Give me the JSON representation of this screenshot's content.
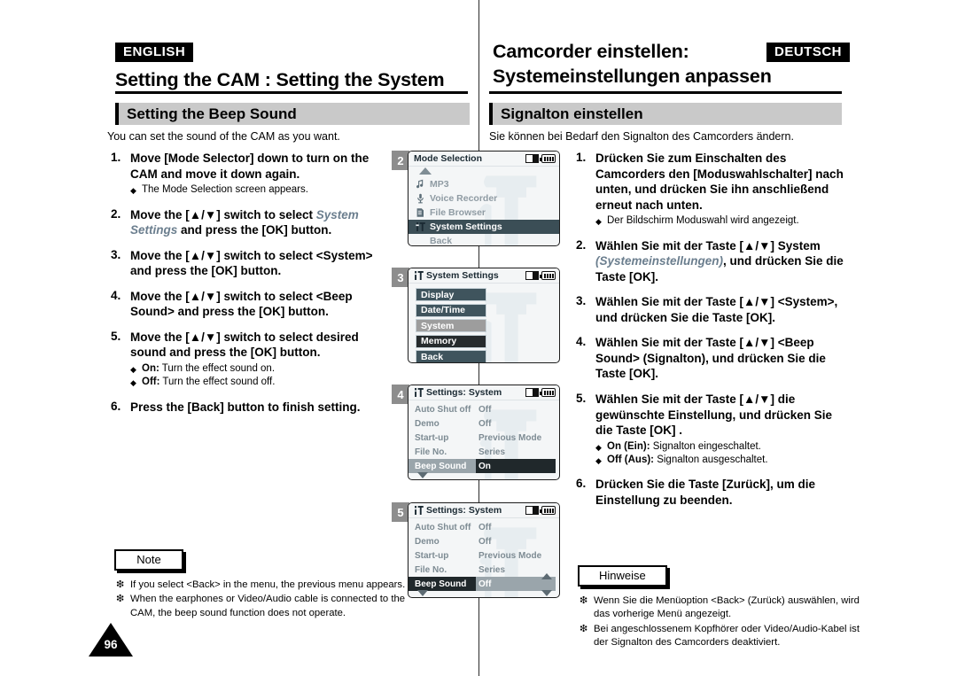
{
  "header": {
    "english_tag": "ENGLISH",
    "english_title": "Setting the CAM : Setting the System",
    "german_tag": "DEUTSCH",
    "german_title_line1": "Camcorder einstellen:",
    "german_title_line2": "Systemeinstellungen anpassen"
  },
  "section": {
    "english_heading": "Setting the Beep Sound",
    "german_heading": "Signalton einstellen",
    "english_intro": "You can set the sound of the CAM as you want.",
    "german_intro": "Sie können bei Bedarf den Signalton des Camcorders ändern."
  },
  "english_steps": [
    {
      "num": "1.",
      "text": "Move [Mode Selector] down to turn on the CAM and move it down again.",
      "subs": [
        {
          "marker": "◆",
          "text": "The Mode Selection screen appears."
        }
      ]
    },
    {
      "num": "2.",
      "pre": "Move the [▲/▼] switch to select ",
      "italic": "System Settings",
      "post": " and press the [OK] button.",
      "subs": []
    },
    {
      "num": "3.",
      "text": "Move the [▲/▼] switch to select <System> and press the [OK] button.",
      "subs": []
    },
    {
      "num": "4.",
      "text": "Move the [▲/▼] switch to select <Beep Sound> and press the [OK] button.",
      "subs": []
    },
    {
      "num": "5.",
      "text": "Move the [▲/▼] switch to select desired sound and press the [OK] button.",
      "subs": [
        {
          "marker": "◆",
          "bold": "On:",
          "text": " Turn the effect sound on."
        },
        {
          "marker": "◆",
          "bold": "Off:",
          "text": " Turn the effect sound off."
        }
      ]
    },
    {
      "num": "6.",
      "text": "Press the [Back] button to finish setting.",
      "subs": []
    }
  ],
  "german_steps": [
    {
      "num": "1.",
      "text": "Drücken Sie zum Einschalten des Camcorders den [Moduswahlschalter] nach unten, und drücken Sie ihn anschließend erneut nach unten.",
      "subs": [
        {
          "marker": "◆",
          "text": "Der Bildschirm Moduswahl wird angezeigt."
        }
      ]
    },
    {
      "num": "2.",
      "pre": "Wählen Sie mit der Taste [▲/▼] System ",
      "italic": "(Systemeinstellungen)",
      "post": ", und drücken Sie die Taste [OK].",
      "subs": []
    },
    {
      "num": "3.",
      "text": "Wählen Sie mit der Taste [▲/▼] <System>, und drücken Sie die Taste [OK].",
      "subs": []
    },
    {
      "num": "4.",
      "text": "Wählen Sie mit der Taste [▲/▼] <Beep Sound> (Signalton), und drücken Sie die Taste [OK].",
      "subs": []
    },
    {
      "num": "5.",
      "text": "Wählen Sie mit der Taste [▲/▼] die gewünschte Einstellung, und drücken Sie die Taste [OK] .",
      "subs": [
        {
          "marker": "◆",
          "bold": "On (Ein):",
          "text": " Signalton eingeschaltet."
        },
        {
          "marker": "◆",
          "bold": "Off (Aus):",
          "text": " Signalton ausgeschaltet."
        }
      ]
    },
    {
      "num": "6.",
      "text": "Drücken Sie die Taste [Zurück], um die Einstellung zu beenden.",
      "subs": []
    }
  ],
  "notes": {
    "english_label": "Note",
    "english_items": [
      "If you select <Back> in the menu, the previous menu appears.",
      "When the earphones or Video/Audio cable is connected to the CAM, the beep sound function does not operate."
    ],
    "german_label": "Hinweise",
    "german_items": [
      "Wenn Sie die Menüoption <Back> (Zurück) auswählen, wird das vorherige Menü angezeigt.",
      "Bei angeschlossenem Kopfhörer oder Video/Audio-Kabel ist der Signalton des Camcorders deaktiviert."
    ],
    "bullet": "❇"
  },
  "page_number": "96",
  "screens": [
    {
      "badge": "2",
      "title": "Mode Selection",
      "icons": [
        "card-icon",
        "battery-icon"
      ],
      "type": "mode-list",
      "items": [
        {
          "icon": "music-note-icon",
          "label": "MP3",
          "selected": false
        },
        {
          "icon": "microphone-icon",
          "label": "Voice Recorder",
          "selected": false
        },
        {
          "icon": "file-icon",
          "label": "File Browser",
          "selected": false
        },
        {
          "icon": "settings-tool-icon",
          "label": "System Settings",
          "selected": true
        },
        {
          "icon": "",
          "label": "Back",
          "selected": false
        }
      ]
    },
    {
      "badge": "3",
      "title": "System Settings",
      "title_icon": "settings-tool-icon",
      "icons": [
        "card-icon",
        "battery-icon"
      ],
      "type": "button-list",
      "items": [
        {
          "label": "Display",
          "shade": "#3f545d"
        },
        {
          "label": "Date/Time",
          "shade": "#3f545d"
        },
        {
          "label": "System",
          "shade": "#9d9d9d"
        },
        {
          "label": "Memory",
          "shade": "#262b2d"
        },
        {
          "label": "Back",
          "shade": "#3f545d"
        }
      ]
    },
    {
      "badge": "4",
      "title": "Settings: System",
      "title_icon": "settings-tool-icon",
      "icons": [
        "card-icon",
        "battery-icon"
      ],
      "type": "settings-table",
      "rows": [
        {
          "key": "Auto Shut off",
          "value": "Off",
          "highlight": "none"
        },
        {
          "key": "Demo",
          "value": "Off",
          "highlight": "none"
        },
        {
          "key": "Start-up",
          "value": "Previous Mode",
          "highlight": "none"
        },
        {
          "key": "File No.",
          "value": "Series",
          "highlight": "none"
        },
        {
          "key": "Beep Sound",
          "value": "On",
          "highlight": "key-gray-value-dark"
        }
      ],
      "scroll_down": true,
      "scroll_up_right": false,
      "scroll_down_right": false
    },
    {
      "badge": "5",
      "title": "Settings: System",
      "title_icon": "settings-tool-icon",
      "icons": [
        "card-icon",
        "battery-icon"
      ],
      "type": "settings-table",
      "rows": [
        {
          "key": "Auto Shut off",
          "value": "Off",
          "highlight": "none"
        },
        {
          "key": "Demo",
          "value": "Off",
          "highlight": "none"
        },
        {
          "key": "Start-up",
          "value": "Previous Mode",
          "highlight": "none"
        },
        {
          "key": "File No.",
          "value": "Series",
          "highlight": "none"
        },
        {
          "key": "Beep Sound",
          "value": "Off",
          "highlight": "key-dark-value-gray"
        }
      ],
      "scroll_down": true,
      "scroll_up_right": true,
      "scroll_down_right": true
    }
  ]
}
